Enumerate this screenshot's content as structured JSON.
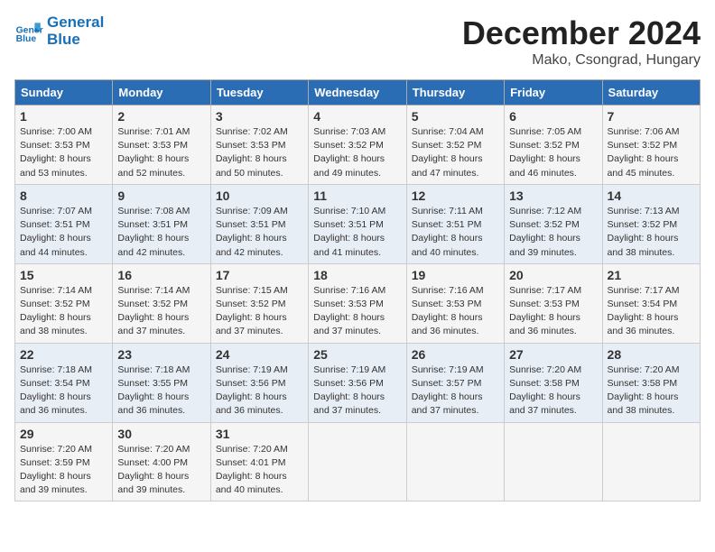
{
  "logo": {
    "line1": "General",
    "line2": "Blue"
  },
  "title": "December 2024",
  "location": "Mako, Csongrad, Hungary",
  "days_of_week": [
    "Sunday",
    "Monday",
    "Tuesday",
    "Wednesday",
    "Thursday",
    "Friday",
    "Saturday"
  ],
  "weeks": [
    [
      {
        "day": "1",
        "sunrise": "7:00 AM",
        "sunset": "3:53 PM",
        "daylight": "8 hours and 53 minutes."
      },
      {
        "day": "2",
        "sunrise": "7:01 AM",
        "sunset": "3:53 PM",
        "daylight": "8 hours and 52 minutes."
      },
      {
        "day": "3",
        "sunrise": "7:02 AM",
        "sunset": "3:53 PM",
        "daylight": "8 hours and 50 minutes."
      },
      {
        "day": "4",
        "sunrise": "7:03 AM",
        "sunset": "3:52 PM",
        "daylight": "8 hours and 49 minutes."
      },
      {
        "day": "5",
        "sunrise": "7:04 AM",
        "sunset": "3:52 PM",
        "daylight": "8 hours and 47 minutes."
      },
      {
        "day": "6",
        "sunrise": "7:05 AM",
        "sunset": "3:52 PM",
        "daylight": "8 hours and 46 minutes."
      },
      {
        "day": "7",
        "sunrise": "7:06 AM",
        "sunset": "3:52 PM",
        "daylight": "8 hours and 45 minutes."
      }
    ],
    [
      {
        "day": "8",
        "sunrise": "7:07 AM",
        "sunset": "3:51 PM",
        "daylight": "8 hours and 44 minutes."
      },
      {
        "day": "9",
        "sunrise": "7:08 AM",
        "sunset": "3:51 PM",
        "daylight": "8 hours and 42 minutes."
      },
      {
        "day": "10",
        "sunrise": "7:09 AM",
        "sunset": "3:51 PM",
        "daylight": "8 hours and 42 minutes."
      },
      {
        "day": "11",
        "sunrise": "7:10 AM",
        "sunset": "3:51 PM",
        "daylight": "8 hours and 41 minutes."
      },
      {
        "day": "12",
        "sunrise": "7:11 AM",
        "sunset": "3:51 PM",
        "daylight": "8 hours and 40 minutes."
      },
      {
        "day": "13",
        "sunrise": "7:12 AM",
        "sunset": "3:52 PM",
        "daylight": "8 hours and 39 minutes."
      },
      {
        "day": "14",
        "sunrise": "7:13 AM",
        "sunset": "3:52 PM",
        "daylight": "8 hours and 38 minutes."
      }
    ],
    [
      {
        "day": "15",
        "sunrise": "7:14 AM",
        "sunset": "3:52 PM",
        "daylight": "8 hours and 38 minutes."
      },
      {
        "day": "16",
        "sunrise": "7:14 AM",
        "sunset": "3:52 PM",
        "daylight": "8 hours and 37 minutes."
      },
      {
        "day": "17",
        "sunrise": "7:15 AM",
        "sunset": "3:52 PM",
        "daylight": "8 hours and 37 minutes."
      },
      {
        "day": "18",
        "sunrise": "7:16 AM",
        "sunset": "3:53 PM",
        "daylight": "8 hours and 37 minutes."
      },
      {
        "day": "19",
        "sunrise": "7:16 AM",
        "sunset": "3:53 PM",
        "daylight": "8 hours and 36 minutes."
      },
      {
        "day": "20",
        "sunrise": "7:17 AM",
        "sunset": "3:53 PM",
        "daylight": "8 hours and 36 minutes."
      },
      {
        "day": "21",
        "sunrise": "7:17 AM",
        "sunset": "3:54 PM",
        "daylight": "8 hours and 36 minutes."
      }
    ],
    [
      {
        "day": "22",
        "sunrise": "7:18 AM",
        "sunset": "3:54 PM",
        "daylight": "8 hours and 36 minutes."
      },
      {
        "day": "23",
        "sunrise": "7:18 AM",
        "sunset": "3:55 PM",
        "daylight": "8 hours and 36 minutes."
      },
      {
        "day": "24",
        "sunrise": "7:19 AM",
        "sunset": "3:56 PM",
        "daylight": "8 hours and 36 minutes."
      },
      {
        "day": "25",
        "sunrise": "7:19 AM",
        "sunset": "3:56 PM",
        "daylight": "8 hours and 37 minutes."
      },
      {
        "day": "26",
        "sunrise": "7:19 AM",
        "sunset": "3:57 PM",
        "daylight": "8 hours and 37 minutes."
      },
      {
        "day": "27",
        "sunrise": "7:20 AM",
        "sunset": "3:58 PM",
        "daylight": "8 hours and 37 minutes."
      },
      {
        "day": "28",
        "sunrise": "7:20 AM",
        "sunset": "3:58 PM",
        "daylight": "8 hours and 38 minutes."
      }
    ],
    [
      {
        "day": "29",
        "sunrise": "7:20 AM",
        "sunset": "3:59 PM",
        "daylight": "8 hours and 39 minutes."
      },
      {
        "day": "30",
        "sunrise": "7:20 AM",
        "sunset": "4:00 PM",
        "daylight": "8 hours and 39 minutes."
      },
      {
        "day": "31",
        "sunrise": "7:20 AM",
        "sunset": "4:01 PM",
        "daylight": "8 hours and 40 minutes."
      },
      null,
      null,
      null,
      null
    ]
  ]
}
